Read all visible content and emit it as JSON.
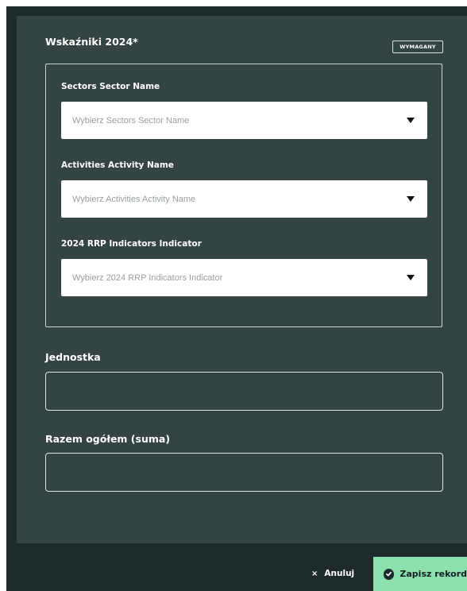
{
  "form": {
    "section_title": "Wskaźniki 2024*",
    "required_badge": "WYMAGANY",
    "sector": {
      "label": "Sectors Sector Name",
      "placeholder": "Wybierz Sectors Sector Name"
    },
    "activity": {
      "label": "Activities Activity Name",
      "placeholder": "Wybierz Activities Activity Name"
    },
    "indicator": {
      "label": "2024 RRP Indicators Indicator",
      "placeholder": "Wybierz 2024 RRP Indicators Indicator"
    },
    "unit": {
      "label": "Jednostka",
      "value": ""
    },
    "total": {
      "label": "Razem ogółem (suma)",
      "value": ""
    }
  },
  "footer": {
    "cancel_icon": "×",
    "cancel_label": "Anuluj",
    "save_label": "Zapisz rekord"
  },
  "colors": {
    "panel": "#334443",
    "backdrop": "#1f2b2b",
    "save_button": "#8ce0ae"
  },
  "icons": {
    "caret": "caret-down-icon",
    "cancel": "close-icon",
    "save": "check-circle-icon"
  }
}
